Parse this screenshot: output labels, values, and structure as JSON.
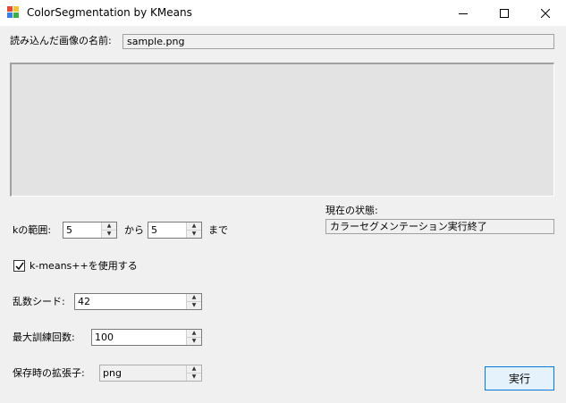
{
  "window": {
    "title": "ColorSegmentation by KMeans",
    "controls": {
      "minimize": "minimize-icon",
      "maximize": "maximize-icon",
      "close": "close-icon"
    }
  },
  "image_name": {
    "label": "読み込んだ画像の名前:",
    "value": "sample.png"
  },
  "status": {
    "label": "現在の状態:",
    "value": "カラーセグメンテーション実行終了"
  },
  "k_range": {
    "label": "kの範囲:",
    "from_value": "5",
    "from_label": "から",
    "to_value": "5",
    "to_label": "まで"
  },
  "kmeanspp": {
    "label": "k-means++を使用する",
    "checked": true
  },
  "seed": {
    "label": "乱数シード:",
    "value": "42"
  },
  "max_iter": {
    "label": "最大訓練回数:",
    "value": "100"
  },
  "extension": {
    "label": "保存時の拡張子:",
    "value": "png"
  },
  "run_button": {
    "label": "実行"
  },
  "colors": {
    "accent": "#0078d7",
    "window_bg": "#f0f0f0"
  }
}
